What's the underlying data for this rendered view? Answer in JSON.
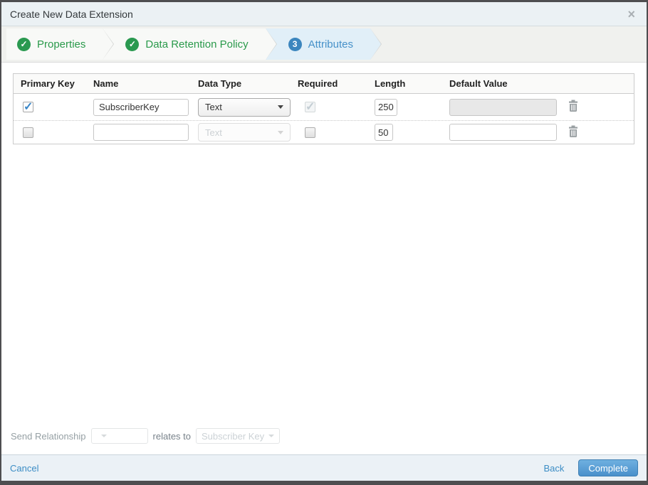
{
  "colors": {
    "success_green": "#2a9950",
    "brand_blue": "#3c86be",
    "link_blue": "#3c8dc5",
    "active_step_bg": "#e1eff8",
    "button_blue": "#4a90cb",
    "disabled_text": "#ccd2d6"
  },
  "icons": {
    "check": "✓",
    "close": "×"
  },
  "modal": {
    "title": "Create New Data Extension"
  },
  "wizard": {
    "steps": [
      {
        "label": "Properties",
        "status": "complete"
      },
      {
        "label": "Data Retention Policy",
        "status": "complete"
      },
      {
        "label": "Attributes",
        "status": "active",
        "number": "3"
      }
    ]
  },
  "attributes_table": {
    "headers": {
      "primary_key": "Primary Key",
      "name": "Name",
      "data_type": "Data Type",
      "required": "Required",
      "length": "Length",
      "default_value": "Default Value"
    },
    "rows": [
      {
        "primary_key": true,
        "name": "SubscriberKey",
        "data_type": "Text",
        "required": true,
        "length": "250",
        "default_value": ""
      },
      {
        "primary_key": false,
        "name": "",
        "data_type": "Text",
        "required": false,
        "length": "50",
        "default_value": ""
      }
    ]
  },
  "send_relationship": {
    "label": "Send Relationship",
    "field_value": "",
    "relates_to": "relates to",
    "target_value": "Subscriber Key"
  },
  "footer": {
    "cancel": "Cancel",
    "back": "Back",
    "complete": "Complete"
  }
}
